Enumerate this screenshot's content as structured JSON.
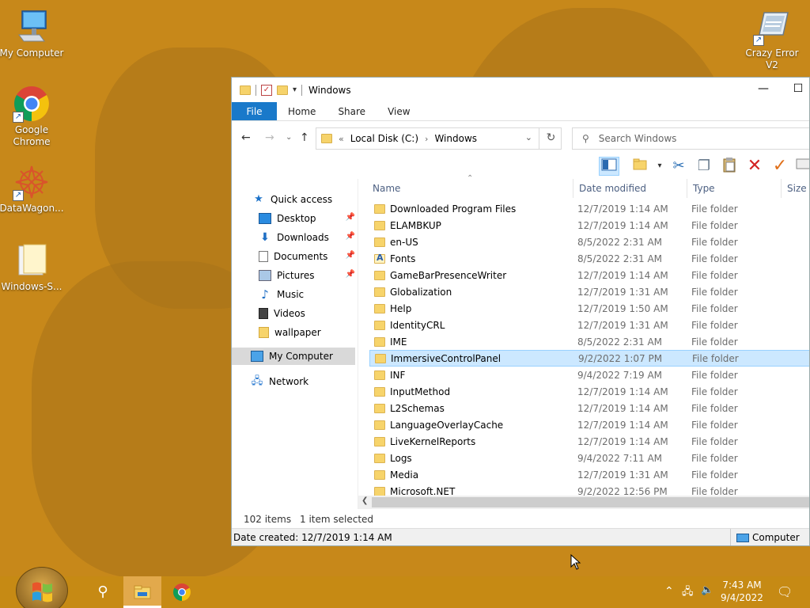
{
  "desktop": {
    "icons": [
      {
        "label": "My Computer",
        "icon": "computer-icon"
      },
      {
        "label": "Google Chrome",
        "icon": "chrome-icon"
      },
      {
        "label": "DataWagon...",
        "icon": "datawagon-icon"
      },
      {
        "label": "Windows-S...",
        "icon": "folder-icon"
      },
      {
        "label": "Crazy Error V2",
        "icon": "crazy-error-icon"
      }
    ]
  },
  "window": {
    "title": "Windows",
    "minimize": "—",
    "maximize": "☐",
    "ribbon_tabs": [
      "File",
      "Home",
      "Share",
      "View"
    ],
    "address": {
      "prefix": "«",
      "crumbs": [
        "Local Disk (C:)",
        "Windows"
      ]
    },
    "search_placeholder": "Search Windows",
    "nav": {
      "quick_access": "Quick access",
      "items": [
        {
          "label": "Desktop",
          "pinned": true
        },
        {
          "label": "Downloads",
          "pinned": true
        },
        {
          "label": "Documents",
          "pinned": true
        },
        {
          "label": "Pictures",
          "pinned": true
        },
        {
          "label": "Music",
          "pinned": false
        },
        {
          "label": "Videos",
          "pinned": false
        },
        {
          "label": "wallpaper",
          "pinned": false
        }
      ],
      "my_computer": "My Computer",
      "network": "Network"
    },
    "columns": [
      "Name",
      "Date modified",
      "Type",
      "Size"
    ],
    "files": [
      {
        "name": "Downloaded Program Files",
        "date": "12/7/2019 1:14 AM",
        "type": "File folder"
      },
      {
        "name": "ELAMBKUP",
        "date": "12/7/2019 1:14 AM",
        "type": "File folder"
      },
      {
        "name": "en-US",
        "date": "8/5/2022 2:31 AM",
        "type": "File folder"
      },
      {
        "name": "Fonts",
        "date": "8/5/2022 2:31 AM",
        "type": "File folder"
      },
      {
        "name": "GameBarPresenceWriter",
        "date": "12/7/2019 1:14 AM",
        "type": "File folder"
      },
      {
        "name": "Globalization",
        "date": "12/7/2019 1:31 AM",
        "type": "File folder"
      },
      {
        "name": "Help",
        "date": "12/7/2019 1:50 AM",
        "type": "File folder"
      },
      {
        "name": "IdentityCRL",
        "date": "12/7/2019 1:31 AM",
        "type": "File folder"
      },
      {
        "name": "IME",
        "date": "8/5/2022 2:31 AM",
        "type": "File folder"
      },
      {
        "name": "ImmersiveControlPanel",
        "date": "9/2/2022 1:07 PM",
        "type": "File folder"
      },
      {
        "name": "INF",
        "date": "9/4/2022 7:19 AM",
        "type": "File folder"
      },
      {
        "name": "InputMethod",
        "date": "12/7/2019 1:14 AM",
        "type": "File folder"
      },
      {
        "name": "L2Schemas",
        "date": "12/7/2019 1:14 AM",
        "type": "File folder"
      },
      {
        "name": "LanguageOverlayCache",
        "date": "12/7/2019 1:14 AM",
        "type": "File folder"
      },
      {
        "name": "LiveKernelReports",
        "date": "12/7/2019 1:14 AM",
        "type": "File folder"
      },
      {
        "name": "Logs",
        "date": "9/4/2022 7:11 AM",
        "type": "File folder"
      },
      {
        "name": "Media",
        "date": "12/7/2019 1:31 AM",
        "type": "File folder"
      },
      {
        "name": "Microsoft.NET",
        "date": "9/2/2022 12:56 PM",
        "type": "File folder"
      }
    ],
    "selected_index": 9,
    "status": {
      "count": "102 items",
      "selected": "1 item selected"
    },
    "details": {
      "date_created": "Date created: 12/7/2019 1:14 AM",
      "location": "Computer"
    }
  },
  "taskbar": {
    "clock_time": "7:43 AM",
    "clock_date": "9/4/2022"
  },
  "colors": {
    "accent": "#1979ca",
    "selection": "#cce8ff",
    "folder": "#f7d46b",
    "desktop": "#c7881a"
  }
}
